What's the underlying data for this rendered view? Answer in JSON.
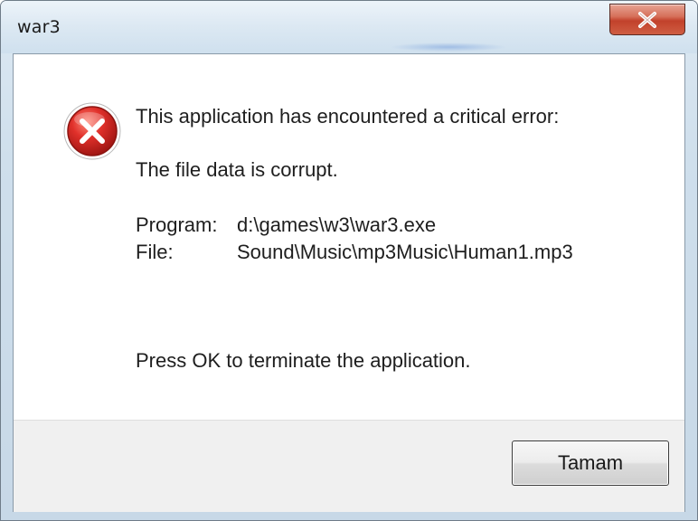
{
  "window": {
    "title": "war3"
  },
  "dialog": {
    "heading": "This application has encountered a critical error:",
    "detail": "The file data is corrupt.",
    "program_label": "Program:",
    "program_value": "d:\\games\\w3\\war3.exe",
    "file_label": "File:",
    "file_value": "Sound\\Music\\mp3Music\\Human1.mp3",
    "instruction": "Press OK to terminate the application.",
    "icon": "error-icon"
  },
  "buttons": {
    "close_icon": "close-icon",
    "ok_label": "Tamam"
  },
  "colors": {
    "error_red": "#c8211c",
    "close_red": "#c2412b"
  }
}
